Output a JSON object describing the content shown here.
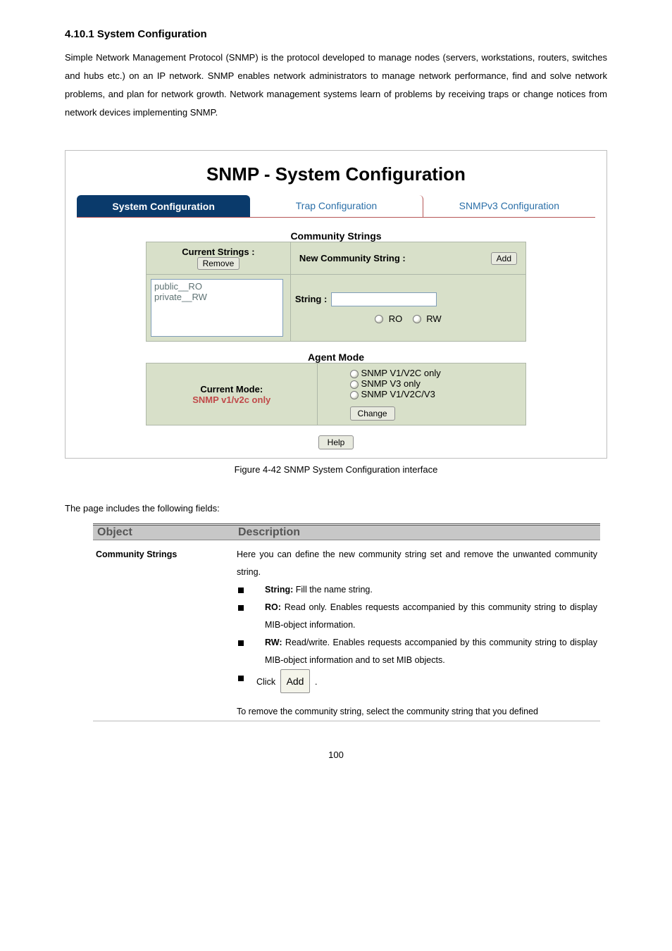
{
  "section_heading": "4.10.1 System Configuration",
  "intro": {
    "lead": "Simple Network Management Protocol (SNMP)",
    "body": " is the protocol developed to manage nodes (servers, workstations, routers, switches and hubs etc.) on an IP network. SNMP enables network administrators to manage network performance, find and solve network problems, and plan for network growth. Network management systems learn of problems by receiving traps or change notices from network devices implementing SNMP."
  },
  "panel": {
    "title": "SNMP - System Configuration",
    "tabs": [
      "System Configuration",
      "Trap Configuration",
      "SNMPv3 Configuration"
    ],
    "community": {
      "group_title": "Community Strings",
      "left_header": "Current Strings :",
      "remove_btn": "Remove",
      "list": [
        "public__RO",
        "private__RW"
      ],
      "right_header": "New Community String :",
      "add_btn": "Add",
      "string_label": "String :",
      "ro_label": "RO",
      "rw_label": "RW"
    },
    "agent": {
      "group_title": "Agent Mode",
      "left_header": "Current Mode:",
      "current_value": "SNMP v1/v2c only",
      "options": [
        "SNMP V1/V2C only",
        "SNMP V3 only",
        "SNMP V1/V2C/V3"
      ],
      "change_btn": "Change"
    },
    "help_btn": "Help"
  },
  "figure_caption_prefix": "Figure 4-42",
  "figure_caption": " SNMP System Configuration interface",
  "below_text": "The page includes the following fields:",
  "desc_table": {
    "headers": [
      "Object",
      "Description"
    ],
    "row_label": "Community Strings",
    "intro": "Here you can define the new community string set and remove the unwanted community string.",
    "bullets": [
      {
        "strong": "String:",
        "text": " Fill the name string."
      },
      {
        "strong": "RO:",
        "text": " Read only. Enables requests accompanied by this community string to display MIB-object information."
      },
      {
        "strong": "RW:",
        "text": " Read/write. Enables requests accompanied by this community string to display MIB-object information and to set MIB objects."
      }
    ],
    "click_text_left": "Click ",
    "click_chip": "Add",
    "click_text_right": ".",
    "remove_para": "To remove the community string, select the community string that you defined"
  },
  "page_number": "100"
}
